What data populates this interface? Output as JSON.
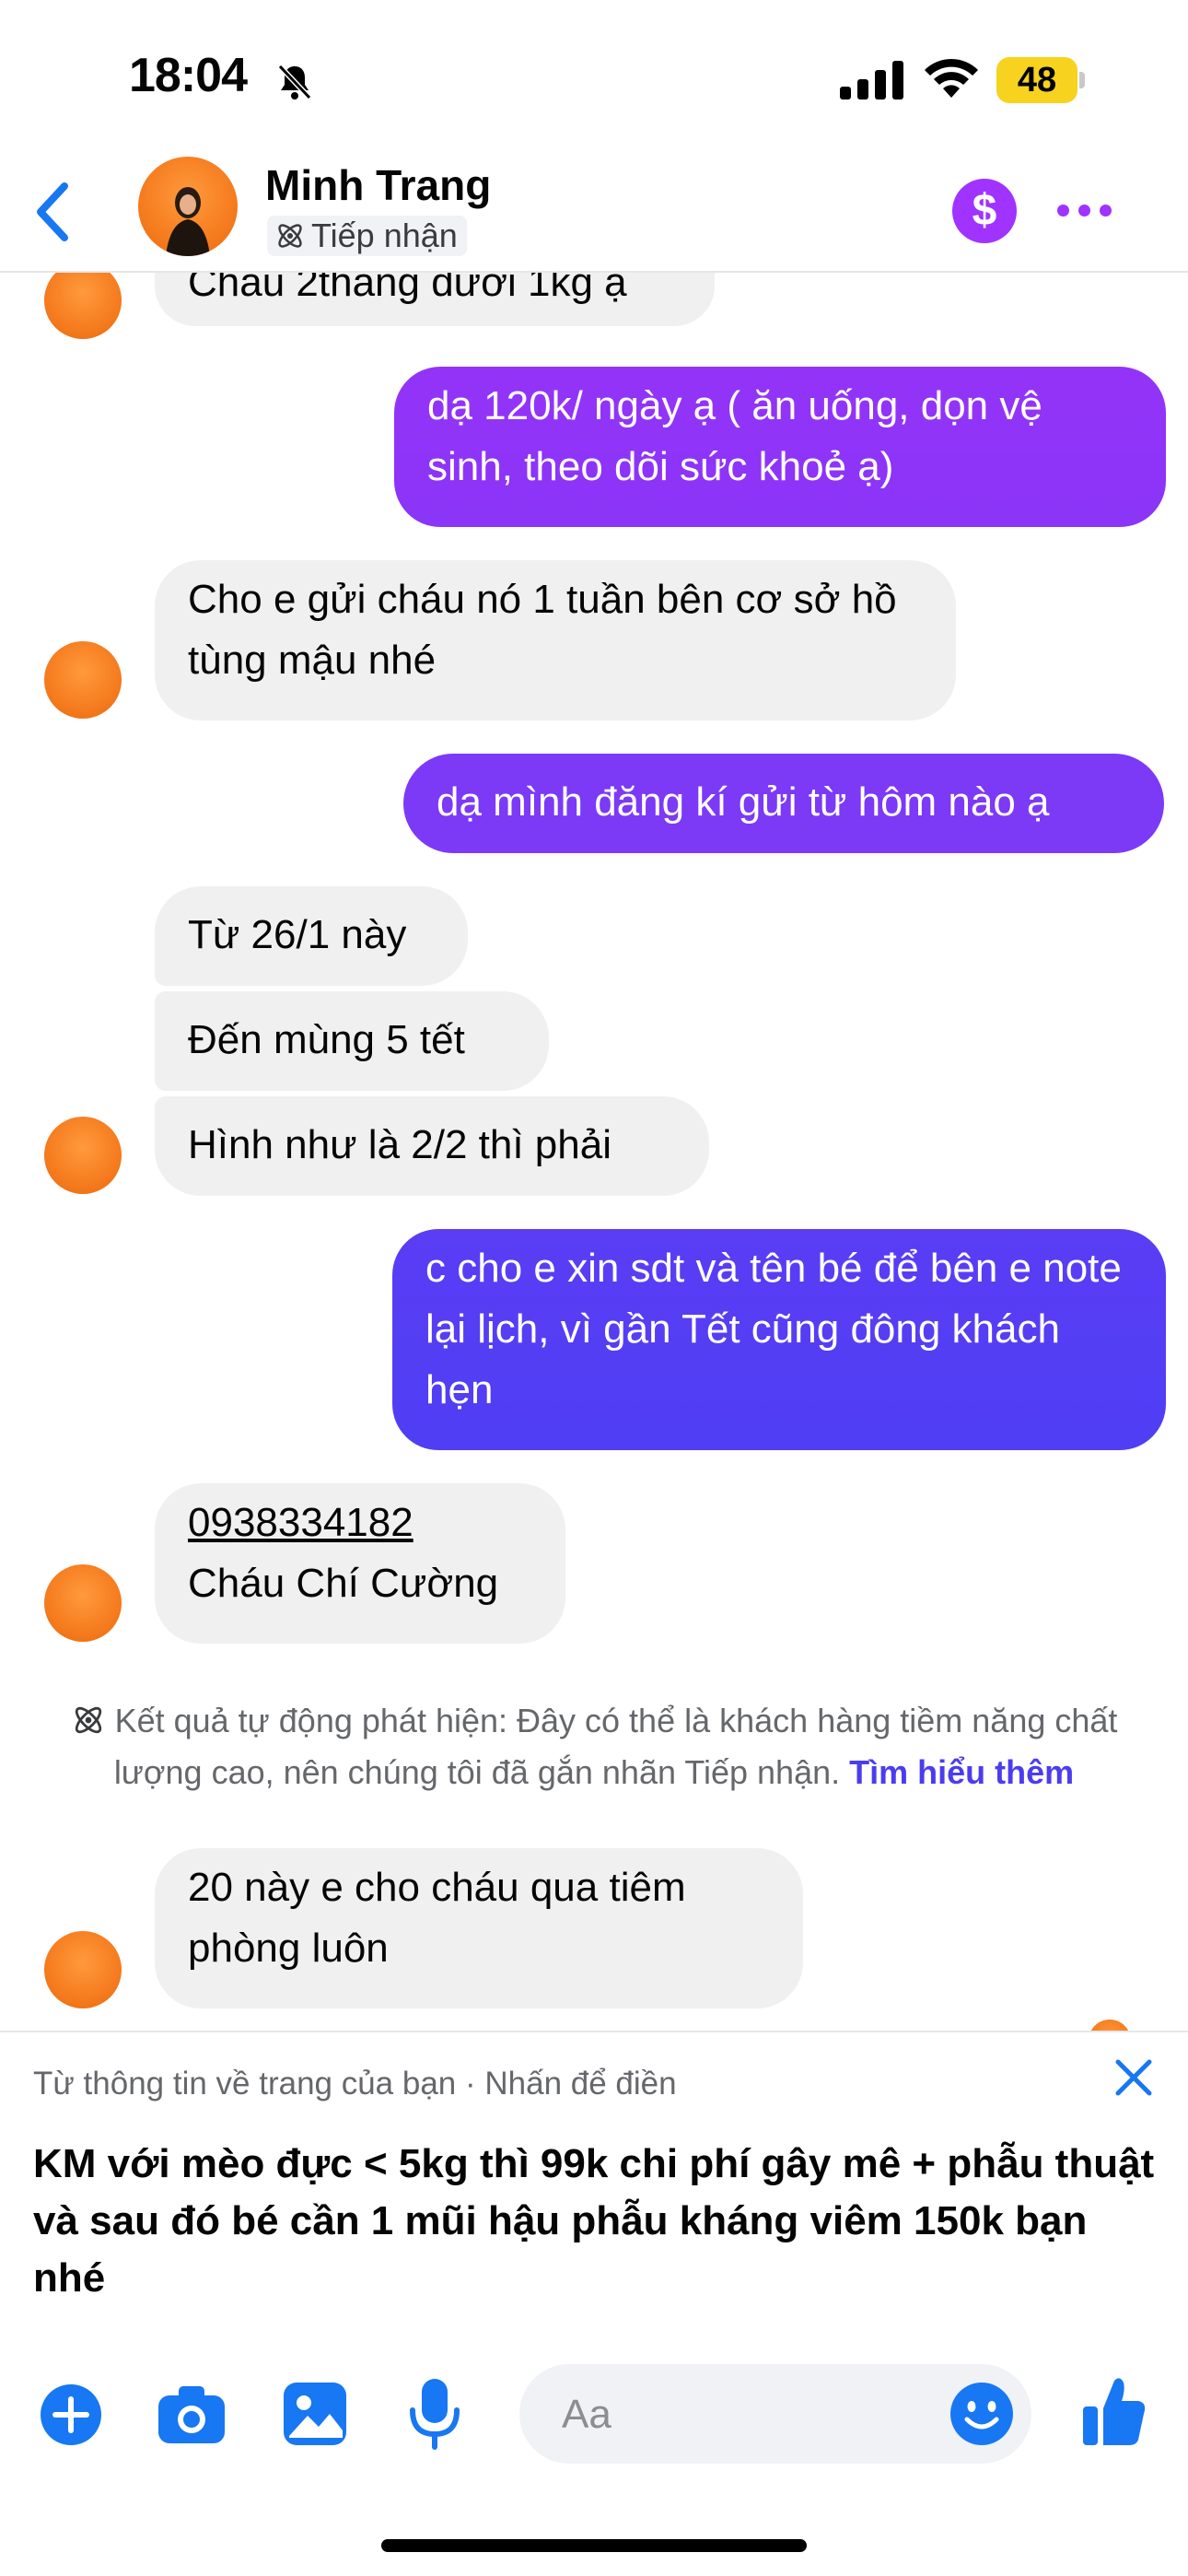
{
  "status_bar": {
    "time": "18:04",
    "battery": "48"
  },
  "header": {
    "name": "Minh Trang",
    "tag": "Tiếp nhận"
  },
  "messages": {
    "m1": "Cháu 2tháng dưới 1kg ạ",
    "m2": "dạ 120k/ ngày ạ ( ăn uống, dọn vệ sinh, theo dõi sức khoẻ ạ)",
    "m3": "Cho e gửi cháu nó 1 tuần bên cơ sở hồ tùng mậu nhé",
    "m4": "dạ mình đăng kí gửi từ hôm nào ạ",
    "m5": "Từ 26/1 này",
    "m6": "Đến mùng 5 tết",
    "m7": "Hình như là 2/2 thì phải",
    "m8": "c cho e xin sdt và tên bé để bên e note lại lịch, vì gần Tết cũng đông khách hẹn",
    "m9_phone": "0938334182",
    "m9_name": "Cháu Chí Cường",
    "m10": "20 này e cho cháu qua tiêm phòng luôn"
  },
  "notice": {
    "text": "Kết quả tự động phát hiện: Đây có thể là khách hàng tiềm năng chất lượng cao, nên chúng tôi đã gắn nhãn Tiếp nhận.",
    "link": "Tìm hiểu thêm"
  },
  "suggestion": {
    "caption": "Từ thông tin về trang của bạn · Nhấn để điền",
    "text": "KM với mèo đực < 5kg thì 99k chi phí gây mê + phẫu thuật và sau đó bé cần 1 mũi hậu phẫu kháng viêm 150k bạn nhé"
  },
  "composer": {
    "placeholder": "Aa"
  },
  "colors": {
    "accent": "#a033ff",
    "outgoing_top": "#9134f7",
    "outgoing_bottom": "#5b3cf5",
    "incoming": "#f0f0f0",
    "messenger_blue": "#1877f2"
  }
}
